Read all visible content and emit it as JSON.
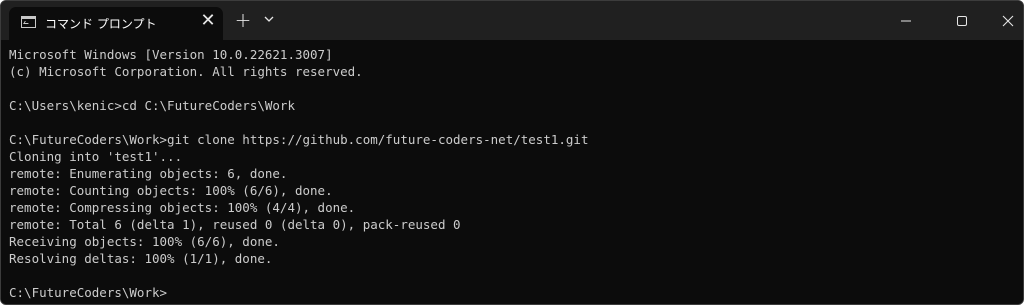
{
  "titlebar": {
    "tab_title": "コマンド プロンプト",
    "close_tab_glyph": "✕",
    "new_tab_glyph": "+"
  },
  "icons": {
    "terminal": "terminal-icon",
    "close_tab": "close-icon",
    "new_tab": "plus-icon",
    "dropdown": "chevron-down-icon",
    "minimize": "minimize-icon",
    "maximize": "maximize-icon",
    "close_window": "close-icon"
  },
  "colors": {
    "titlebar": "#202020",
    "terminal_bg": "#0c0c0c",
    "terminal_text": "#cccccc"
  },
  "terminal": {
    "lines": [
      "Microsoft Windows [Version 10.0.22621.3007]",
      "(c) Microsoft Corporation. All rights reserved.",
      "",
      "C:\\Users\\kenic>cd C:\\FutureCoders\\Work",
      "",
      "C:\\FutureCoders\\Work>git clone https://github.com/future-coders-net/test1.git",
      "Cloning into 'test1'...",
      "remote: Enumerating objects: 6, done.",
      "remote: Counting objects: 100% (6/6), done.",
      "remote: Compressing objects: 100% (4/4), done.",
      "remote: Total 6 (delta 1), reused 0 (delta 0), pack-reused 0",
      "Receiving objects: 100% (6/6), done.",
      "Resolving deltas: 100% (1/1), done.",
      "",
      "C:\\FutureCoders\\Work>"
    ]
  }
}
